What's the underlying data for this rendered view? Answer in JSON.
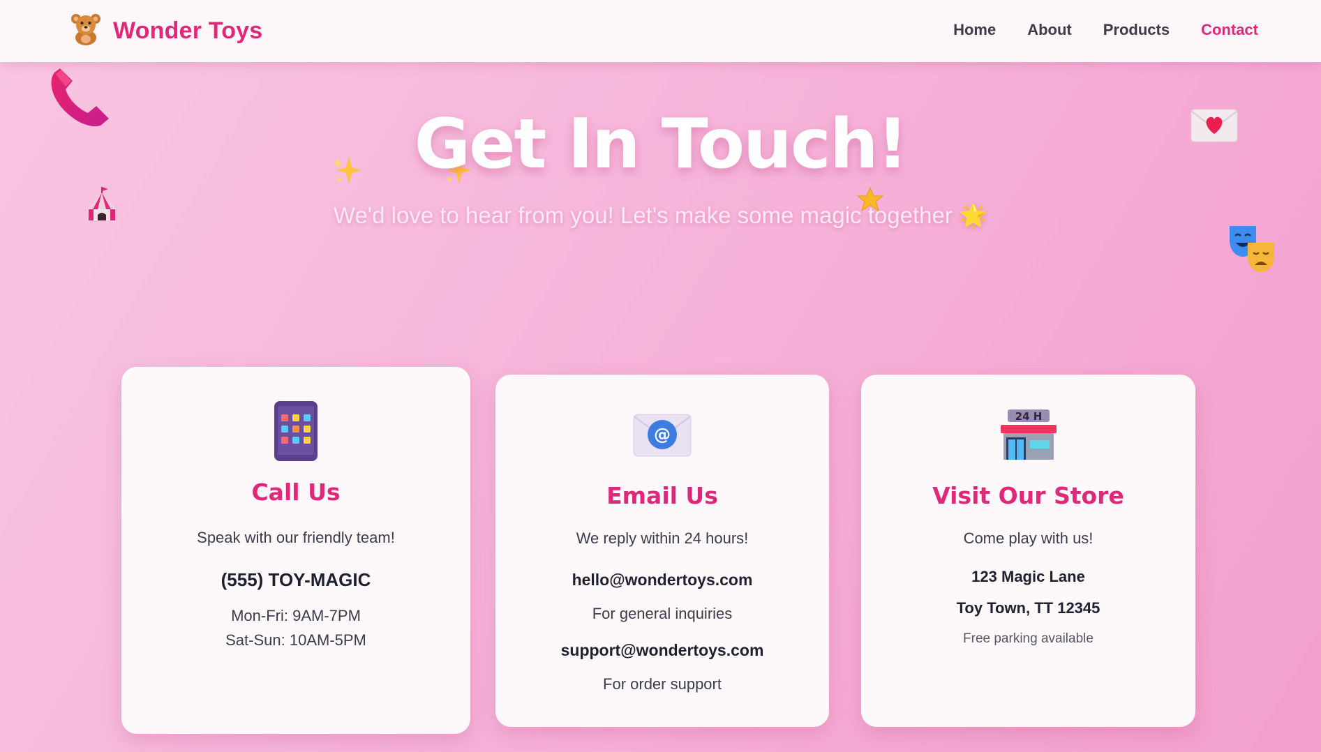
{
  "brand": {
    "name": "Wonder Toys",
    "logo_icon": "teddy-bear-icon"
  },
  "nav": {
    "items": [
      {
        "label": "Home"
      },
      {
        "label": "About"
      },
      {
        "label": "Products"
      },
      {
        "label": "Contact",
        "active": true
      }
    ]
  },
  "hero": {
    "title": "Get In Touch!",
    "subtitle": "We'd love to hear from you! Let's make some magic together 🌟"
  },
  "cards": {
    "call": {
      "icon": "phone-icon",
      "title": "Call Us",
      "description": "Speak with our friendly team!",
      "phone": "(555) TOY-MAGIC",
      "hours_weekday": "Mon-Fri: 9AM-7PM",
      "hours_weekend": "Sat-Sun: 10AM-5PM"
    },
    "email": {
      "icon": "email-icon",
      "title": "Email Us",
      "description": "We reply within 24 hours!",
      "general_email": "hello@wondertoys.com",
      "general_note": "For general inquiries",
      "support_email": "support@wondertoys.com",
      "support_note": "For order support"
    },
    "store": {
      "icon": "store-icon",
      "title": "Visit Our Store",
      "description": "Come play with us!",
      "address_line1": "123 Magic Lane",
      "address_line2": "Toy Town, TT 12345",
      "note": "Free parking available"
    }
  },
  "colors": {
    "accent": "#e0287a",
    "background": "#f6b5da",
    "card": "#fdf9fa",
    "text": "#3b3b4a"
  }
}
